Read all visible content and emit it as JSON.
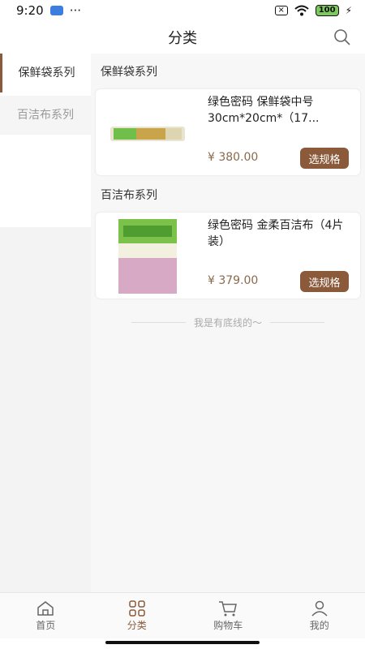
{
  "status_bar": {
    "time": "9:20",
    "dots": "···",
    "battery": "100"
  },
  "header": {
    "title": "分类"
  },
  "sidebar": {
    "items": [
      {
        "label": "保鲜袋系列",
        "active": true
      },
      {
        "label": "百洁布系列",
        "active": false
      }
    ]
  },
  "sections": [
    {
      "title": "保鲜袋系列",
      "product": {
        "name": "绿色密码 保鲜袋中号30cm*20cm*（17...",
        "price": "¥ 380.00",
        "button": "选规格"
      }
    },
    {
      "title": "百洁布系列",
      "product": {
        "name": "绿色密码 金柔百洁布（4片装）",
        "price": "¥ 379.00",
        "button": "选规格"
      }
    }
  ],
  "end_text": "我是有底线的～",
  "tabbar": {
    "items": [
      {
        "label": "首页",
        "icon": "home-icon",
        "active": false
      },
      {
        "label": "分类",
        "icon": "category-icon",
        "active": true
      },
      {
        "label": "购物车",
        "icon": "cart-icon",
        "active": false
      },
      {
        "label": "我的",
        "icon": "profile-icon",
        "active": false
      }
    ]
  },
  "colors": {
    "accent": "#8a5a3a",
    "price": "#8a6a4a",
    "background": "#f7f7f7"
  }
}
